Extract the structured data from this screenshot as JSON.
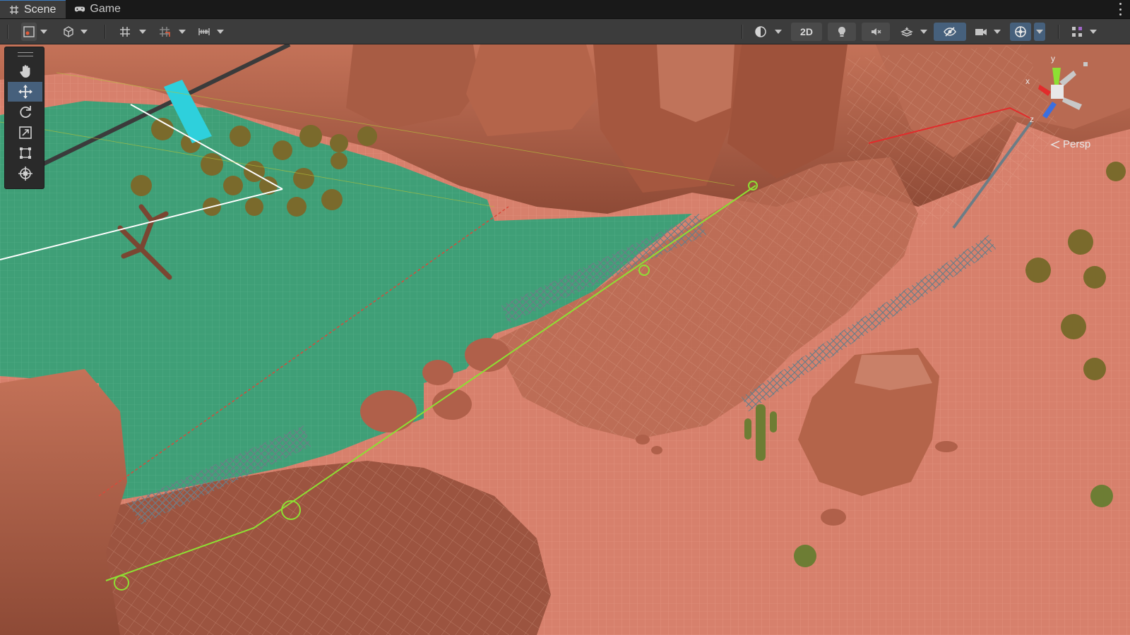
{
  "tabs": [
    {
      "label": "Scene",
      "icon": "grid-hash-icon",
      "active": true
    },
    {
      "label": "Game",
      "icon": "gamepad-icon",
      "active": false
    }
  ],
  "toolbar": {
    "view_2d_label": "2D"
  },
  "tools": [
    "hand-tool",
    "move-tool",
    "rotate-tool",
    "scale-tool",
    "rect-tool",
    "transform-tool"
  ],
  "active_tool": "move-tool",
  "gizmo": {
    "axis_y": "y",
    "axis_x": "x",
    "axis_z": "z",
    "projection_label": "Persp"
  },
  "colors": {
    "accent": "#46607c",
    "terrain_green": "#3f9f77",
    "terrain_salmon": "#d7806c",
    "rock": "#b3624a"
  }
}
